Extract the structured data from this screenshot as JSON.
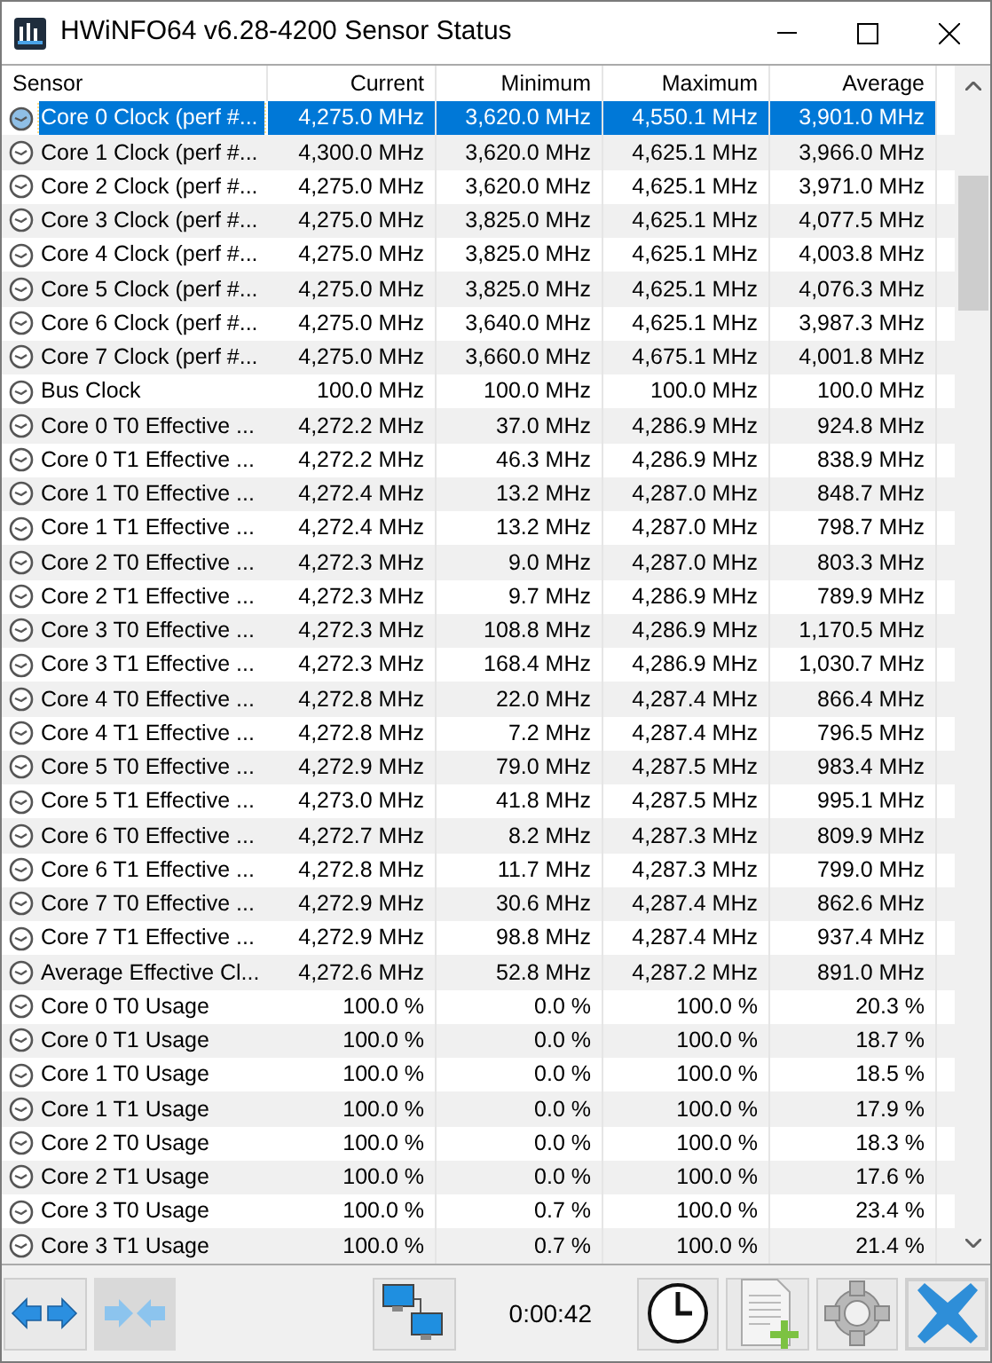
{
  "window": {
    "title": "HWiNFO64 v6.28-4200 Sensor Status"
  },
  "table": {
    "columns": [
      "Sensor",
      "Current",
      "Minimum",
      "Maximum",
      "Average"
    ],
    "rows": [
      {
        "sensor": "Core 0 Clock (perf #...",
        "current": "4,275.0 MHz",
        "minimum": "3,620.0 MHz",
        "maximum": "4,550.1 MHz",
        "average": "3,901.0 MHz",
        "selected": true
      },
      {
        "sensor": "Core 1 Clock (perf #...",
        "current": "4,300.0 MHz",
        "minimum": "3,620.0 MHz",
        "maximum": "4,625.1 MHz",
        "average": "3,966.0 MHz",
        "selected": false
      },
      {
        "sensor": "Core 2 Clock (perf #...",
        "current": "4,275.0 MHz",
        "minimum": "3,620.0 MHz",
        "maximum": "4,625.1 MHz",
        "average": "3,971.0 MHz",
        "selected": false
      },
      {
        "sensor": "Core 3 Clock (perf #...",
        "current": "4,275.0 MHz",
        "minimum": "3,825.0 MHz",
        "maximum": "4,625.1 MHz",
        "average": "4,077.5 MHz",
        "selected": false
      },
      {
        "sensor": "Core 4 Clock (perf #...",
        "current": "4,275.0 MHz",
        "minimum": "3,825.0 MHz",
        "maximum": "4,625.1 MHz",
        "average": "4,003.8 MHz",
        "selected": false
      },
      {
        "sensor": "Core 5 Clock (perf #...",
        "current": "4,275.0 MHz",
        "minimum": "3,825.0 MHz",
        "maximum": "4,625.1 MHz",
        "average": "4,076.3 MHz",
        "selected": false
      },
      {
        "sensor": "Core 6 Clock (perf #...",
        "current": "4,275.0 MHz",
        "minimum": "3,640.0 MHz",
        "maximum": "4,625.1 MHz",
        "average": "3,987.3 MHz",
        "selected": false
      },
      {
        "sensor": "Core 7 Clock (perf #...",
        "current": "4,275.0 MHz",
        "minimum": "3,660.0 MHz",
        "maximum": "4,675.1 MHz",
        "average": "4,001.8 MHz",
        "selected": false
      },
      {
        "sensor": "Bus Clock",
        "current": "100.0 MHz",
        "minimum": "100.0 MHz",
        "maximum": "100.0 MHz",
        "average": "100.0 MHz",
        "selected": false
      },
      {
        "sensor": "Core 0 T0 Effective ...",
        "current": "4,272.2 MHz",
        "minimum": "37.0 MHz",
        "maximum": "4,286.9 MHz",
        "average": "924.8 MHz",
        "selected": false
      },
      {
        "sensor": "Core 0 T1 Effective ...",
        "current": "4,272.2 MHz",
        "minimum": "46.3 MHz",
        "maximum": "4,286.9 MHz",
        "average": "838.9 MHz",
        "selected": false
      },
      {
        "sensor": "Core 1 T0 Effective ...",
        "current": "4,272.4 MHz",
        "minimum": "13.2 MHz",
        "maximum": "4,287.0 MHz",
        "average": "848.7 MHz",
        "selected": false
      },
      {
        "sensor": "Core 1 T1 Effective ...",
        "current": "4,272.4 MHz",
        "minimum": "13.2 MHz",
        "maximum": "4,287.0 MHz",
        "average": "798.7 MHz",
        "selected": false
      },
      {
        "sensor": "Core 2 T0 Effective ...",
        "current": "4,272.3 MHz",
        "minimum": "9.0 MHz",
        "maximum": "4,287.0 MHz",
        "average": "803.3 MHz",
        "selected": false
      },
      {
        "sensor": "Core 2 T1 Effective ...",
        "current": "4,272.3 MHz",
        "minimum": "9.7 MHz",
        "maximum": "4,286.9 MHz",
        "average": "789.9 MHz",
        "selected": false
      },
      {
        "sensor": "Core 3 T0 Effective ...",
        "current": "4,272.3 MHz",
        "minimum": "108.8 MHz",
        "maximum": "4,286.9 MHz",
        "average": "1,170.5 MHz",
        "selected": false
      },
      {
        "sensor": "Core 3 T1 Effective ...",
        "current": "4,272.3 MHz",
        "minimum": "168.4 MHz",
        "maximum": "4,286.9 MHz",
        "average": "1,030.7 MHz",
        "selected": false
      },
      {
        "sensor": "Core 4 T0 Effective ...",
        "current": "4,272.8 MHz",
        "minimum": "22.0 MHz",
        "maximum": "4,287.4 MHz",
        "average": "866.4 MHz",
        "selected": false
      },
      {
        "sensor": "Core 4 T1 Effective ...",
        "current": "4,272.8 MHz",
        "minimum": "7.2 MHz",
        "maximum": "4,287.4 MHz",
        "average": "796.5 MHz",
        "selected": false
      },
      {
        "sensor": "Core 5 T0 Effective ...",
        "current": "4,272.9 MHz",
        "minimum": "79.0 MHz",
        "maximum": "4,287.5 MHz",
        "average": "983.4 MHz",
        "selected": false
      },
      {
        "sensor": "Core 5 T1 Effective ...",
        "current": "4,273.0 MHz",
        "minimum": "41.8 MHz",
        "maximum": "4,287.5 MHz",
        "average": "995.1 MHz",
        "selected": false
      },
      {
        "sensor": "Core 6 T0 Effective ...",
        "current": "4,272.7 MHz",
        "minimum": "8.2 MHz",
        "maximum": "4,287.3 MHz",
        "average": "809.9 MHz",
        "selected": false
      },
      {
        "sensor": "Core 6 T1 Effective ...",
        "current": "4,272.8 MHz",
        "minimum": "11.7 MHz",
        "maximum": "4,287.3 MHz",
        "average": "799.0 MHz",
        "selected": false
      },
      {
        "sensor": "Core 7 T0 Effective ...",
        "current": "4,272.9 MHz",
        "minimum": "30.6 MHz",
        "maximum": "4,287.4 MHz",
        "average": "862.6 MHz",
        "selected": false
      },
      {
        "sensor": "Core 7 T1 Effective ...",
        "current": "4,272.9 MHz",
        "minimum": "98.8 MHz",
        "maximum": "4,287.4 MHz",
        "average": "937.4 MHz",
        "selected": false
      },
      {
        "sensor": "Average Effective Cl...",
        "current": "4,272.6 MHz",
        "minimum": "52.8 MHz",
        "maximum": "4,287.2 MHz",
        "average": "891.0 MHz",
        "selected": false
      },
      {
        "sensor": "Core 0 T0 Usage",
        "current": "100.0 %",
        "minimum": "0.0 %",
        "maximum": "100.0 %",
        "average": "20.3 %",
        "selected": false
      },
      {
        "sensor": "Core 0 T1 Usage",
        "current": "100.0 %",
        "minimum": "0.0 %",
        "maximum": "100.0 %",
        "average": "18.7 %",
        "selected": false
      },
      {
        "sensor": "Core 1 T0 Usage",
        "current": "100.0 %",
        "minimum": "0.0 %",
        "maximum": "100.0 %",
        "average": "18.5 %",
        "selected": false
      },
      {
        "sensor": "Core 1 T1 Usage",
        "current": "100.0 %",
        "minimum": "0.0 %",
        "maximum": "100.0 %",
        "average": "17.9 %",
        "selected": false
      },
      {
        "sensor": "Core 2 T0 Usage",
        "current": "100.0 %",
        "minimum": "0.0 %",
        "maximum": "100.0 %",
        "average": "18.3 %",
        "selected": false
      },
      {
        "sensor": "Core 2 T1 Usage",
        "current": "100.0 %",
        "minimum": "0.0 %",
        "maximum": "100.0 %",
        "average": "17.6 %",
        "selected": false
      },
      {
        "sensor": "Core 3 T0 Usage",
        "current": "100.0 %",
        "minimum": "0.7 %",
        "maximum": "100.0 %",
        "average": "23.4 %",
        "selected": false
      },
      {
        "sensor": "Core 3 T1 Usage",
        "current": "100.0 %",
        "minimum": "0.7 %",
        "maximum": "100.0 %",
        "average": "21.4 %",
        "selected": false
      }
    ]
  },
  "toolbar": {
    "elapsed": "0:00:42",
    "buttons": [
      {
        "kind": "expand",
        "pressed": false,
        "focused": false
      },
      {
        "kind": "collapse",
        "pressed": true,
        "focused": false
      },
      {
        "kind": "network",
        "pressed": false,
        "focused": false
      },
      {
        "kind": "clock",
        "pressed": false,
        "focused": false
      },
      {
        "kind": "report",
        "pressed": false,
        "focused": false
      },
      {
        "kind": "settings",
        "pressed": false,
        "focused": false
      },
      {
        "kind": "close",
        "pressed": false,
        "focused": true
      }
    ]
  }
}
